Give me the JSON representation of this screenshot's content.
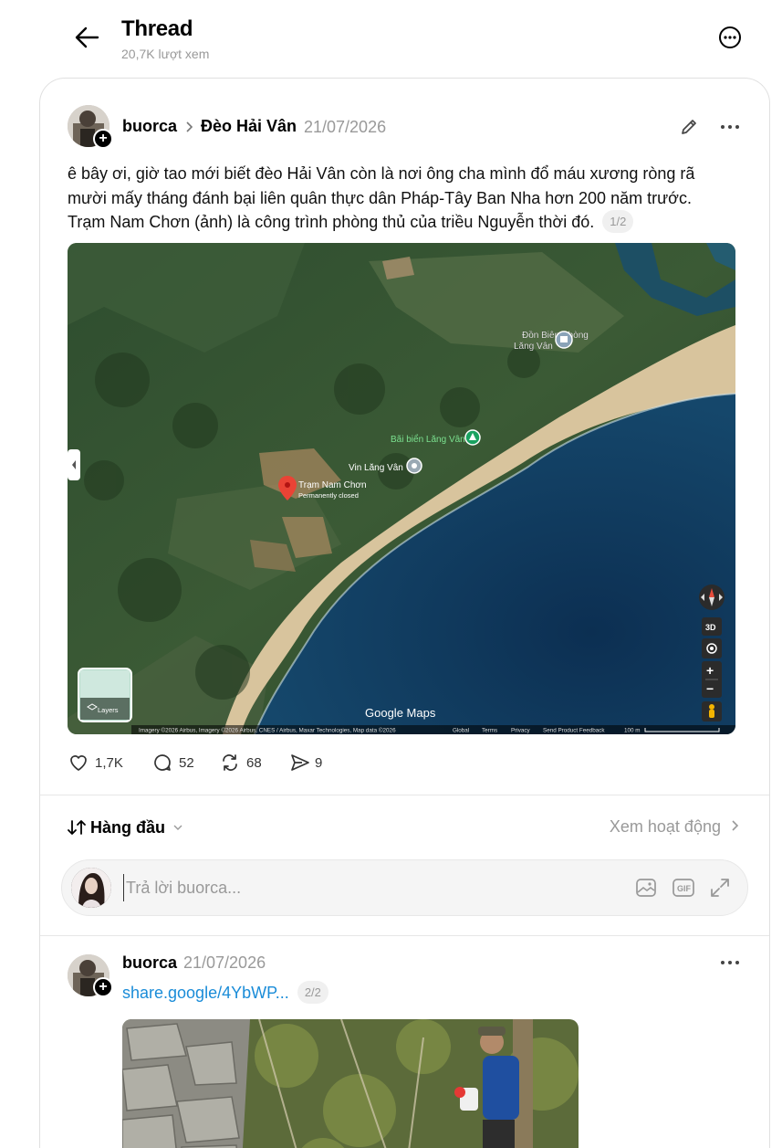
{
  "header": {
    "title": "Thread",
    "views": "20,7K lượt xem"
  },
  "post": {
    "username": "buorca",
    "topic": "Đèo Hải Vân",
    "date": "21/07/2026",
    "text": "ê bây ơi, giờ tao mới biết đèo Hải Vân còn là nơi ông cha mình đổ máu xương ròng rã mười mấy tháng đánh bại liên quân thực dân Pháp-Tây Ban Nha hơn 200 năm trước. Trạm Nam Chơn (ảnh) là công trình phòng thủ của triều Nguyễn thời đó.",
    "pager": "1/2",
    "stats": {
      "likes": "1,7K",
      "replies": "52",
      "reposts": "68",
      "shares": "9"
    }
  },
  "map": {
    "pin_title": "Trạm Nam Chơn",
    "pin_status": "Permanently closed",
    "places": {
      "border_post": "Đồn Biên Phòng\nLăng Vân",
      "beach": "Bãi biển Lăng Vân",
      "resort": "Vin Lăng Vân"
    },
    "layers_label": "Layers",
    "logo": "Google Maps",
    "btn_3d": "3D",
    "zoom_in": "+",
    "zoom_out": "−",
    "footer": {
      "imagery": "Imagery ©2026 Airbus, Imagery ©2026 Airbus, CNES / Airbus, Maxar Technologies, Map data ©2026",
      "global": "Global",
      "terms": "Terms",
      "privacy": "Privacy",
      "feedback": "Send Product Feedback",
      "scale": "100 m"
    },
    "colors": {
      "sea": "#0f3a5e",
      "sand": "#d9c29b",
      "forest": "#2c4a2a"
    }
  },
  "sort": {
    "label": "Hàng đầu",
    "activity": "Xem hoạt động"
  },
  "reply": {
    "placeholder": "Trả lời buorca..."
  },
  "post2": {
    "username": "buorca",
    "date": "21/07/2026",
    "link": "share.google/4YbWP...",
    "pager": "2/2"
  }
}
